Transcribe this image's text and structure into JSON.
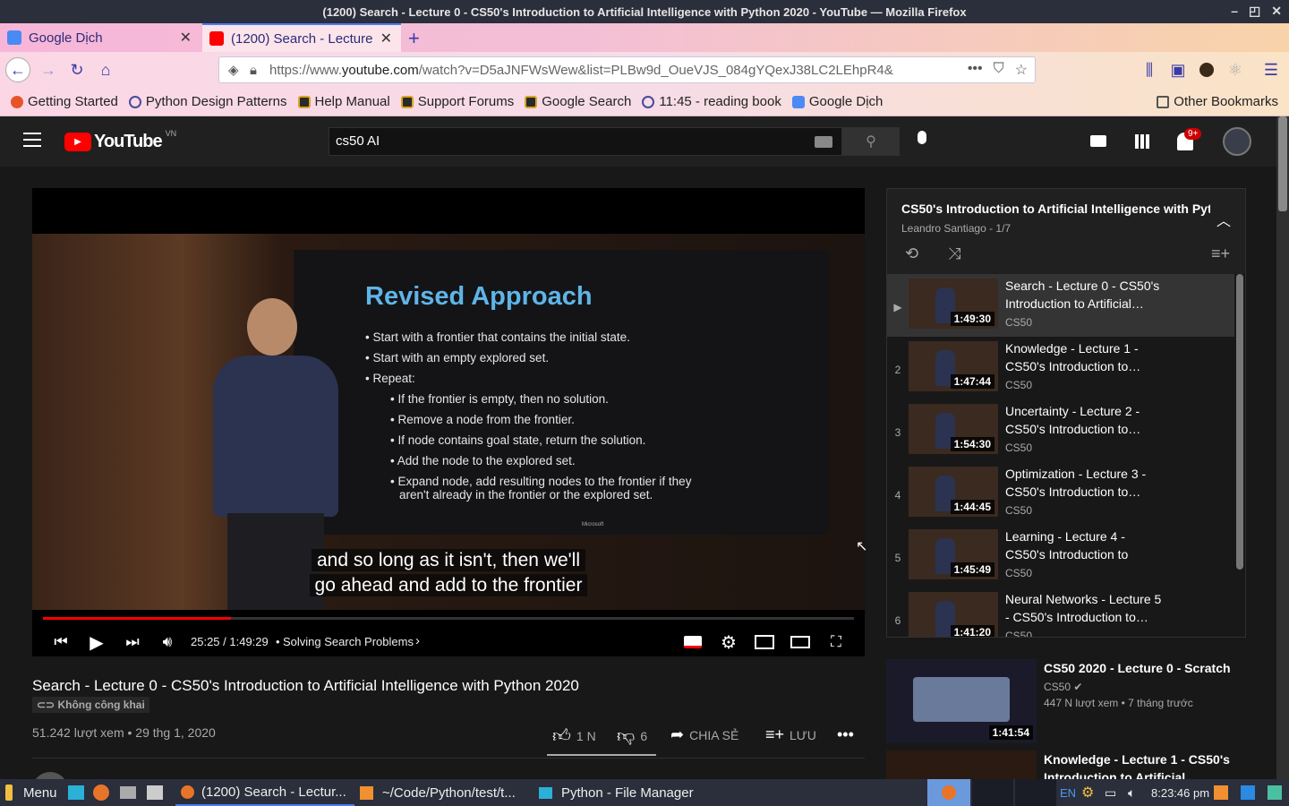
{
  "window": {
    "title": "(1200) Search - Lecture 0 - CS50's Introduction to Artificial Intelligence with Python 2020 - YouTube — Mozilla Firefox"
  },
  "tabs": [
    {
      "label": "Google Dịch"
    },
    {
      "label": "(1200) Search - Lecture"
    }
  ],
  "url": {
    "prefix": "https://www.",
    "domain": "youtube.com",
    "rest": "/watch?v=D5aJNFWsWew&list=PLBw9d_OueVJS_084gYQexJ38LC2LEhpR4&"
  },
  "bookmarks": [
    {
      "label": "Getting Started",
      "color": "#e8542a"
    },
    {
      "label": "Python Design Patterns",
      "color": "#4a4a9a"
    },
    {
      "label": "Help Manual",
      "color": "#d8a420"
    },
    {
      "label": "Support Forums",
      "color": "#d8a420"
    },
    {
      "label": "Google Search",
      "color": "#d8a420"
    },
    {
      "label": "11:45 - reading book",
      "color": "#4a4a9a"
    },
    {
      "label": "Google Dịch",
      "color": "#4a8af4"
    }
  ],
  "other_bookmarks": "Other Bookmarks",
  "youtube": {
    "logo_text": "YouTube",
    "region": "VN",
    "search_value": "cs50 AI",
    "notif_count": "9+"
  },
  "slide": {
    "title": "Revised Approach",
    "bullets": [
      {
        "text": "• Start with a frontier that contains the initial state.",
        "sub": false
      },
      {
        "text": "• Start with an empty explored set.",
        "sub": false
      },
      {
        "text": "• Repeat:",
        "sub": false
      },
      {
        "text": "• If the frontier is empty, then no solution.",
        "sub": true
      },
      {
        "text": "• Remove a node from the frontier.",
        "sub": true
      },
      {
        "text": "• If node contains goal state, return the solution.",
        "sub": true
      },
      {
        "text": "• Add the node to the explored set.",
        "sub": true
      },
      {
        "text": "• Expand node, add resulting nodes to the frontier if they",
        "sub": true
      },
      {
        "text": "aren't already in the frontier or the explored set.",
        "sub": true
      }
    ],
    "brand": "Microsoft"
  },
  "caption": {
    "line1": "and so long as it isn't, then we'll",
    "line2": "go ahead and add to the frontier"
  },
  "player": {
    "time": "25:25 / 1:49:29",
    "chapter": "Solving Search Problems",
    "progress": 0.232
  },
  "video": {
    "title": "Search - Lecture 0 - CS50's Introduction to Artificial Intelligence with Python 2020",
    "visibility": "Không công khai",
    "views": "51.242 lượt xem • 29 thg 1, 2020",
    "likes": "1 N",
    "dislikes": "6",
    "share": "CHIA SẺ",
    "save": "LƯU"
  },
  "playlist": {
    "title": "CS50's Introduction to Artificial Intelligence with Pyth",
    "owner": "Leandro Santiago - 1/7",
    "items": [
      {
        "idx": "▶",
        "title": "Search - Lecture 0 - CS50's Introduction to Artificial…",
        "channel": "CS50",
        "duration": "1:49:30",
        "current": true
      },
      {
        "idx": "2",
        "title": "Knowledge - Lecture 1 - CS50's Introduction to…",
        "channel": "CS50",
        "duration": "1:47:44",
        "current": false
      },
      {
        "idx": "3",
        "title": "Uncertainty - Lecture 2 - CS50's Introduction to…",
        "channel": "CS50",
        "duration": "1:54:30",
        "current": false
      },
      {
        "idx": "4",
        "title": "Optimization - Lecture 3 - CS50's Introduction to…",
        "channel": "CS50",
        "duration": "1:44:45",
        "current": false
      },
      {
        "idx": "5",
        "title": "Learning - Lecture 4 - CS50's Introduction to Artificial…",
        "channel": "CS50",
        "duration": "1:45:49",
        "current": false
      },
      {
        "idx": "6",
        "title": "Neural Networks - Lecture 5 - CS50's Introduction to…",
        "channel": "CS50",
        "duration": "1:41:20",
        "current": false
      }
    ]
  },
  "recommendations": [
    {
      "title": "CS50 2020 - Lecture 0 - Scratch",
      "channel": "CS50",
      "stats": "447 N lượt xem • 7 tháng trước",
      "duration": "1:41:54"
    },
    {
      "title": "Knowledge - Lecture 1 - CS50's Introduction to Artificial",
      "channel": "",
      "stats": "",
      "duration": ""
    }
  ],
  "taskbar": {
    "menu": "Menu",
    "items": [
      "(1200) Search - Lectur...",
      "~/Code/Python/test/t...",
      "Python - File Manager"
    ],
    "lang": "EN",
    "clock": "8:23:46 pm"
  }
}
